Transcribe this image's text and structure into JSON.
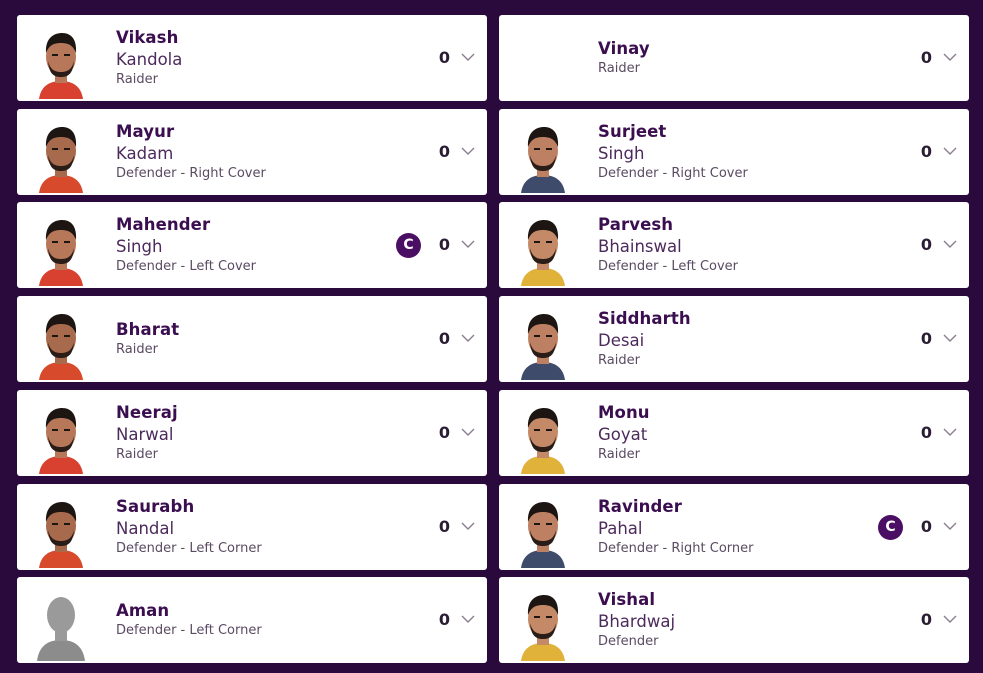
{
  "players": [
    {
      "first": "Vikash",
      "last": "Kandola",
      "role": "Raider",
      "points": "0",
      "captain": false,
      "avatar": "player-photo"
    },
    {
      "first": "Vinay",
      "last": "",
      "role": "Raider",
      "points": "0",
      "captain": false,
      "avatar": "none"
    },
    {
      "first": "Mayur",
      "last": "Kadam",
      "role": "Defender - Right Cover",
      "points": "0",
      "captain": false,
      "avatar": "player-photo"
    },
    {
      "first": "Surjeet",
      "last": "Singh",
      "role": "Defender - Right Cover",
      "points": "0",
      "captain": false,
      "avatar": "player-photo"
    },
    {
      "first": "Mahender",
      "last": "Singh",
      "role": "Defender - Left Cover",
      "points": "0",
      "captain": true,
      "badge": "C",
      "avatar": "player-photo"
    },
    {
      "first": "Parvesh",
      "last": "Bhainswal",
      "role": "Defender - Left Cover",
      "points": "0",
      "captain": false,
      "avatar": "player-photo"
    },
    {
      "first": "Bharat",
      "last": "",
      "role": "Raider",
      "points": "0",
      "captain": false,
      "avatar": "player-photo"
    },
    {
      "first": "Siddharth",
      "last": "Desai",
      "role": "Raider",
      "points": "0",
      "captain": false,
      "avatar": "player-photo"
    },
    {
      "first": "Neeraj",
      "last": "Narwal",
      "role": "Raider",
      "points": "0",
      "captain": false,
      "avatar": "player-photo"
    },
    {
      "first": "Monu",
      "last": "Goyat",
      "role": "Raider",
      "points": "0",
      "captain": false,
      "avatar": "player-photo"
    },
    {
      "first": "Saurabh",
      "last": "Nandal",
      "role": "Defender - Left Corner",
      "points": "0",
      "captain": false,
      "avatar": "player-photo"
    },
    {
      "first": "Ravinder",
      "last": "Pahal",
      "role": "Defender - Right Corner",
      "points": "0",
      "captain": true,
      "badge": "C",
      "avatar": "player-photo"
    },
    {
      "first": "Aman",
      "last": "",
      "role": "Defender - Left Corner",
      "points": "0",
      "captain": false,
      "avatar": "placeholder-silhouette"
    },
    {
      "first": "Vishal",
      "last": "Bhardwaj",
      "role": "Defender",
      "points": "0",
      "captain": false,
      "avatar": "player-photo"
    }
  ],
  "icons": {
    "expand": "chevron-down-icon",
    "captain": "captain-badge-icon"
  },
  "colors": {
    "background": "#2a0a3d",
    "card": "#ffffff",
    "name": "#3a0e4f",
    "captain_badge": "#4a0f63"
  }
}
